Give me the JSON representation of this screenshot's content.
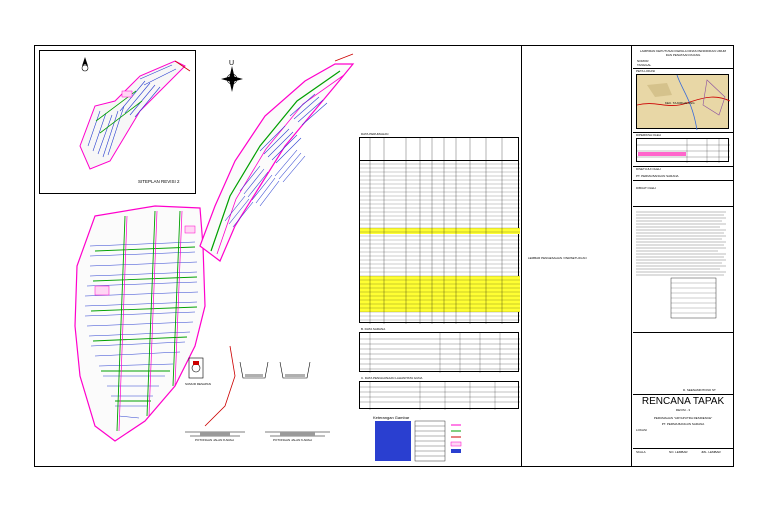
{
  "inset": {
    "label": "SITEPLAN REVISI 2"
  },
  "table_title": "DATA PERUMAHAN",
  "table2_title": "B. DATA SARANA",
  "table3_title": "C. DATA PENGGUNAAN LAHAN/TATA GUNA",
  "legend_title": "Keterangan Gambar",
  "section_labels": {
    "potongan_a": "POTONGAN JALAN 8 ARAH",
    "potongan_b": "POTONGAN JALAN 6 ARAH",
    "sumur": "SUMUR RESAPAN"
  },
  "middle_note": "LEMBAR PENGESAHAN / PERSETUJUAN",
  "titleblock": {
    "lampiran": "LAMPIRAN KEPUTUSAN KEPALA DINAS PENDIDIKAN UMUM DAN PENATAAN RUANG",
    "nomor": "NOMOR",
    "tanggal": "TANGGAL",
    "lokasi_heading": "PETA LOKASI",
    "map_label": "KEC. TAJURHALANG",
    "diperiksa": "DIPERIKSA OLEH",
    "disetujui": "DISETUJUI OLEH",
    "dibuat": "DIBUAT OLEH",
    "pemohon": "PT. PERMA BANGUN SARANA",
    "rencana_tapak": "RENCANA TAPAK",
    "revisi": "REVISI - 3",
    "kegiatan": "PERUMAHAN \"ARYAPUTRA RESIDENCE\"",
    "pt": "PT. PERMA BANGUN SARANA",
    "lokasi": "LOKASI",
    "skala": "SKALA",
    "lembar": "NO. LEMBAR",
    "jml_lembar": "JML. LEMBAR",
    "signer": "D. SEENAMINTONO ST"
  },
  "colors": {
    "road_pink": "#ff00cc",
    "road_green": "#00a000",
    "lot_blue": "#2a3fd0",
    "highlight_yellow": "#ffff33",
    "map_tan": "#e8d7a6"
  }
}
